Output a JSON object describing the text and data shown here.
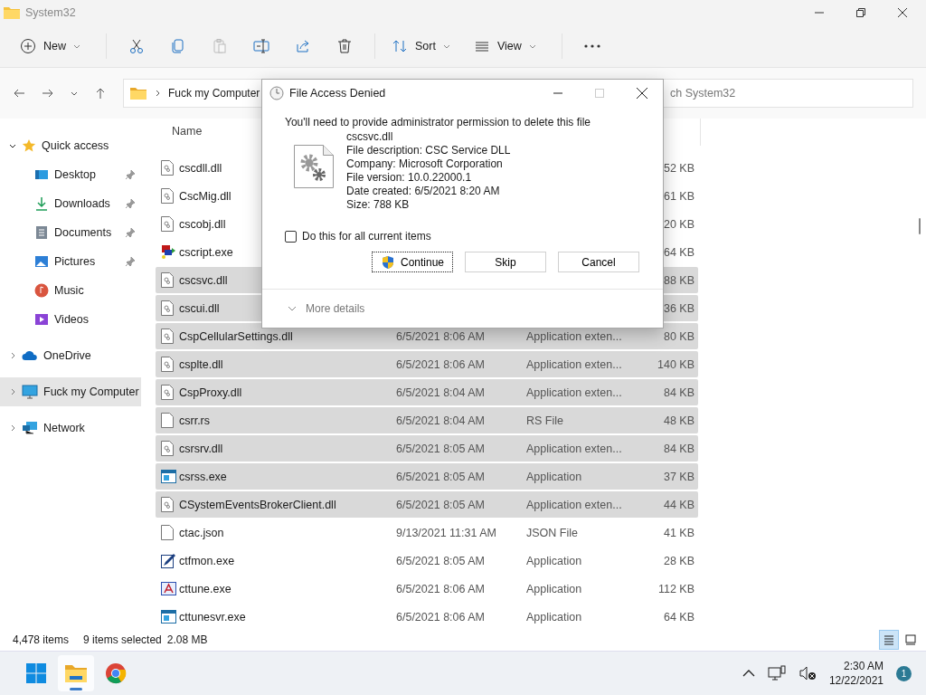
{
  "window": {
    "title": "System32"
  },
  "toolbar": [
    {
      "kind": "new",
      "label": "New"
    },
    {
      "kind": "cut",
      "disabled": false
    },
    {
      "kind": "copy",
      "disabled": false
    },
    {
      "kind": "paste",
      "disabled": true
    },
    {
      "kind": "rename",
      "disabled": false
    },
    {
      "kind": "share",
      "disabled": false
    },
    {
      "kind": "delete",
      "disabled": false
    },
    {
      "kind": "sort",
      "label": "Sort"
    },
    {
      "kind": "view",
      "label": "View"
    },
    {
      "kind": "more",
      "disabled": false
    }
  ],
  "address": {
    "crumbs": [
      "Fuck my Computer"
    ]
  },
  "search": {
    "placeholder": "ch System32"
  },
  "sidebar": {
    "items": [
      {
        "label": "Quick access",
        "kind": "star",
        "expanded": true,
        "selected": false,
        "children": [
          {
            "label": "Desktop",
            "kind": "desktop",
            "pinned": true,
            "selected": false
          },
          {
            "label": "Downloads",
            "kind": "downloads",
            "pinned": true,
            "selected": false
          },
          {
            "label": "Documents",
            "kind": "documents",
            "pinned": true,
            "selected": false
          },
          {
            "label": "Pictures",
            "kind": "pictures",
            "pinned": true,
            "selected": false
          },
          {
            "label": "Music",
            "kind": "music",
            "pinned": false,
            "selected": false
          },
          {
            "label": "Videos",
            "kind": "videos",
            "pinned": false,
            "selected": false
          }
        ]
      },
      {
        "label": "OneDrive",
        "kind": "cloud",
        "expanded": false,
        "selected": false
      },
      {
        "label": "Fuck my Computer",
        "kind": "computer",
        "expanded": false,
        "selected": true
      },
      {
        "label": "Network",
        "kind": "network",
        "expanded": false,
        "selected": false
      }
    ]
  },
  "table": {
    "columns": [
      "Name"
    ],
    "rows": [
      {
        "name": "cscdll.dll",
        "size": "52 KB",
        "kind": "dll",
        "selected": false
      },
      {
        "name": "CscMig.dll",
        "size": "61 KB",
        "kind": "dll",
        "selected": false
      },
      {
        "name": "cscobj.dll",
        "size": "20 KB",
        "kind": "dll",
        "selected": false
      },
      {
        "name": "cscript.exe",
        "size": "64 KB",
        "kind": "script",
        "selected": false
      },
      {
        "name": "cscsvc.dll",
        "size": "88 KB",
        "kind": "dll",
        "selected": true
      },
      {
        "name": "cscui.dll",
        "size": "36 KB",
        "kind": "dll",
        "selected": true
      },
      {
        "name": "CspCellularSettings.dll",
        "date": "6/5/2021 8:06 AM",
        "type": "Application exten...",
        "size": "80 KB",
        "kind": "dll",
        "selected": true
      },
      {
        "name": "csplte.dll",
        "date": "6/5/2021 8:06 AM",
        "type": "Application exten...",
        "size": "140 KB",
        "kind": "dll",
        "selected": true
      },
      {
        "name": "CspProxy.dll",
        "date": "6/5/2021 8:04 AM",
        "type": "Application exten...",
        "size": "84 KB",
        "kind": "dll",
        "selected": true
      },
      {
        "name": "csrr.rs",
        "date": "6/5/2021 8:04 AM",
        "type": "RS File",
        "size": "48 KB",
        "kind": "blank",
        "selected": true
      },
      {
        "name": "csrsrv.dll",
        "date": "6/5/2021 8:05 AM",
        "type": "Application exten...",
        "size": "84 KB",
        "kind": "dll",
        "selected": true
      },
      {
        "name": "csrss.exe",
        "date": "6/5/2021 8:05 AM",
        "type": "Application",
        "size": "37 KB",
        "kind": "app",
        "selected": true
      },
      {
        "name": "CSystemEventsBrokerClient.dll",
        "date": "6/5/2021 8:05 AM",
        "type": "Application exten...",
        "size": "44 KB",
        "kind": "dll",
        "selected": true
      },
      {
        "name": "ctac.json",
        "date": "9/13/2021 11:31 AM",
        "type": "JSON File",
        "size": "41 KB",
        "kind": "blank",
        "selected": false
      },
      {
        "name": "ctfmon.exe",
        "date": "6/5/2021 8:05 AM",
        "type": "Application",
        "size": "28 KB",
        "kind": "pen",
        "selected": false
      },
      {
        "name": "cttune.exe",
        "date": "6/5/2021 8:06 AM",
        "type": "Application",
        "size": "112 KB",
        "kind": "font",
        "selected": false
      },
      {
        "name": "cttunesvr.exe",
        "date": "6/5/2021 8:06 AM",
        "type": "Application",
        "size": "64 KB",
        "kind": "app",
        "selected": false
      }
    ]
  },
  "status_bar": {
    "count": "4,478 items",
    "selection": "9 items selected",
    "size": "2.08 MB",
    "views": [
      {
        "kind": "details",
        "selected": true
      },
      {
        "kind": "tiles",
        "selected": false
      }
    ]
  },
  "dialog": {
    "title": "File Access Denied",
    "message": "You'll need to provide administrator permission to delete this file",
    "details": [
      "cscsvc.dll",
      "File description: CSC Service DLL",
      "Company: Microsoft Corporation",
      "File version: 10.0.22000.1",
      "Date created: 6/5/2021 8:20 AM",
      "Size: 788 KB"
    ],
    "checkbox": {
      "label": "Do this for all current items",
      "checked": false
    },
    "buttons": [
      {
        "label": "Continue",
        "kind": "elevated",
        "focused": true
      },
      {
        "label": "Skip",
        "kind": "plain",
        "focused": false
      },
      {
        "label": "Cancel",
        "kind": "plain",
        "focused": false
      }
    ],
    "more_details": {
      "label": "More details",
      "expanded": false
    }
  },
  "taskbar": {
    "apps": [
      {
        "kind": "start",
        "active": false
      },
      {
        "kind": "explorer",
        "active": true
      },
      {
        "kind": "chrome",
        "active": false
      }
    ],
    "time": "2:30 AM",
    "date": "12/22/2021",
    "badge": "1"
  }
}
